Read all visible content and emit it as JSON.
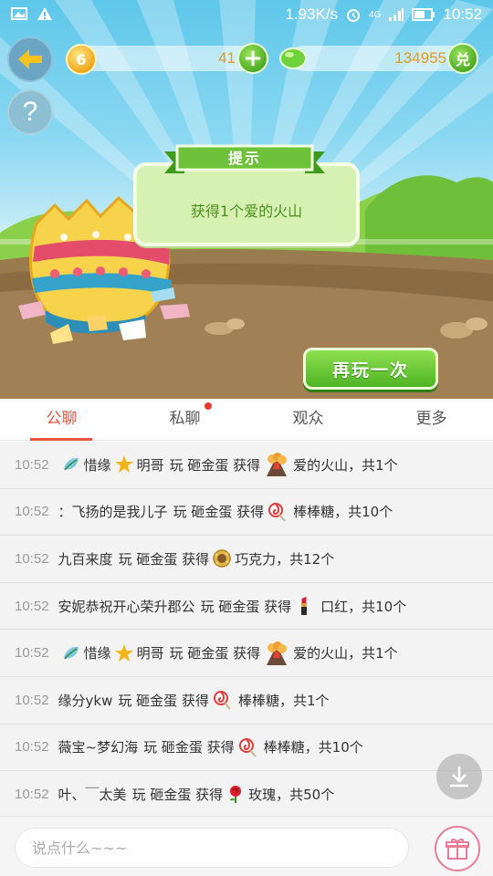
{
  "status_bar": {
    "net_speed": "1.93K/s",
    "network": "4G",
    "time": "10:52"
  },
  "game": {
    "coins": "41",
    "coin_level_badge": "6",
    "gems": "134955",
    "redeem_label": "兑",
    "add_label": "+",
    "help_label": "?",
    "hint_title": "提示",
    "hint_text": "获得1个爱的火山",
    "replay_label": "再玩一次"
  },
  "tabs": [
    {
      "label": "公聊",
      "active": true
    },
    {
      "label": "私聊",
      "active": false,
      "has_dot": true
    },
    {
      "label": "观众",
      "active": false
    },
    {
      "label": "更多",
      "active": false
    }
  ],
  "messages": [
    {
      "time": "10:52",
      "pre_icon": "leaf-icon",
      "user_a": "惜缘",
      "mid_icon": "star-icon",
      "user_b": "明哥",
      "action": "玩 砸金蛋 获得",
      "gift_icon": "volcano-icon",
      "gift": "爱的火山，共1个"
    },
    {
      "time": "10:52",
      "user": "：飞扬的是我儿子",
      "action": "玩 砸金蛋 获得",
      "gift_icon": "lollipop-icon",
      "gift": "棒棒糖，共10个"
    },
    {
      "time": "10:52",
      "user": "九百来度",
      "action": "玩 砸金蛋 获得",
      "gift_icon": "chocolate-icon",
      "gift": "巧克力，共12个"
    },
    {
      "time": "10:52",
      "user": "安妮恭祝开心荣升郡公",
      "action": "玩 砸金蛋 获得",
      "gift_icon": "lipstick-icon",
      "gift": "口红，共10个"
    },
    {
      "time": "10:52",
      "pre_icon": "leaf-icon",
      "user_a": "惜缘",
      "mid_icon": "star-icon",
      "user_b": "明哥",
      "action": "玩 砸金蛋 获得",
      "gift_icon": "volcano-icon",
      "gift": "爱的火山，共1个"
    },
    {
      "time": "10:52",
      "user": "缘分ykw",
      "action": "玩 砸金蛋 获得",
      "gift_icon": "lollipop-icon",
      "gift": "棒棒糖，共1个"
    },
    {
      "time": "10:52",
      "user": "薇宝~梦幻海",
      "action": "玩 砸金蛋 获得",
      "gift_icon": "lollipop-icon",
      "gift": "棒棒糖，共10个"
    },
    {
      "time": "10:52",
      "user": "叶、￣太美",
      "action": "玩 砸金蛋 获得",
      "gift_icon": "rose-icon",
      "gift": "玫瑰，共50个"
    }
  ],
  "input": {
    "placeholder": "说点什么~~~",
    "value": ""
  },
  "colors": {
    "accent": "#e8543c",
    "game_green": "#4fb424",
    "coin_text": "#e39a1a"
  }
}
